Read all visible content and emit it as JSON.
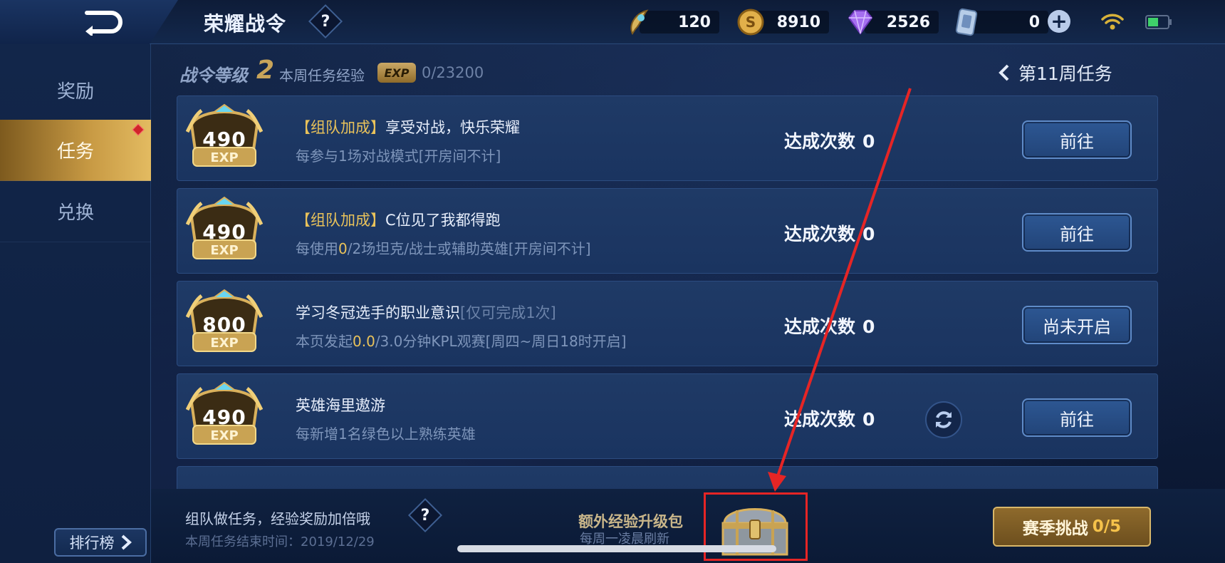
{
  "header": {
    "title": "荣耀战令",
    "help_label": "?",
    "currencies": [
      {
        "icon": "quill-token-icon",
        "value": "120"
      },
      {
        "icon": "gold-coin-icon",
        "value": "8910"
      },
      {
        "icon": "diamond-icon",
        "value": "2526"
      },
      {
        "icon": "ticket-card-icon",
        "value": "0"
      }
    ],
    "add_label": "+"
  },
  "sidebar": {
    "items": [
      {
        "label": "奖励",
        "active": false
      },
      {
        "label": "任务",
        "active": true
      },
      {
        "label": "兑换",
        "active": false
      }
    ],
    "ranking_label": "排行榜"
  },
  "level_bar": {
    "level_label": "战令等级",
    "level": "2",
    "week_exp_label": "本周任务经验",
    "exp_badge": "EXP",
    "week_exp_value": "0/23200",
    "week_nav": "第11周任务"
  },
  "tasks": [
    {
      "exp": "490",
      "exp_unit": "EXP",
      "tag": "【组队加成】",
      "title": "享受对战，快乐荣耀",
      "limit": "",
      "desc_parts": [
        "每参与1场对战模式[开房间不计]"
      ],
      "count_label": "达成次数",
      "count": "0",
      "button": "前往",
      "has_refresh": false
    },
    {
      "exp": "490",
      "exp_unit": "EXP",
      "tag": "【组队加成】",
      "title": "C位见了我都得跑",
      "limit": "",
      "desc_parts": [
        "每使用",
        "0",
        "/2场坦克/战士或辅助英雄[开房间不计]"
      ],
      "count_label": "达成次数",
      "count": "0",
      "button": "前往",
      "has_refresh": false
    },
    {
      "exp": "800",
      "exp_unit": "EXP",
      "tag": "",
      "title": "学习冬冠选手的职业意识",
      "limit": "[仅可完成1次]",
      "desc_parts": [
        "本页发起",
        "0.0",
        "/3.0分钟KPL观赛[周四~周日18时开启]"
      ],
      "count_label": "达成次数",
      "count": "0",
      "button": "尚未开启",
      "has_refresh": false
    },
    {
      "exp": "490",
      "exp_unit": "EXP",
      "tag": "",
      "title": "英雄海里遨游",
      "limit": "",
      "desc_parts": [
        "每新增1名绿色以上熟练英雄"
      ],
      "count_label": "达成次数",
      "count": "0",
      "button": "前往",
      "has_refresh": true
    }
  ],
  "bottom": {
    "team_tip": "组队做任务，经验奖励加倍哦",
    "help_label": "?",
    "end_time": "本周任务结束时间：2019/12/29",
    "pack_title": "额外经验升级包",
    "pack_subtitle": "每周一凌晨刷新",
    "season_label": "赛季挑战",
    "season_progress": "0/5"
  },
  "colors": {
    "accent_gold": "#e9c25a",
    "annotation_red": "#e62525",
    "button_blue": "#2d5793"
  }
}
